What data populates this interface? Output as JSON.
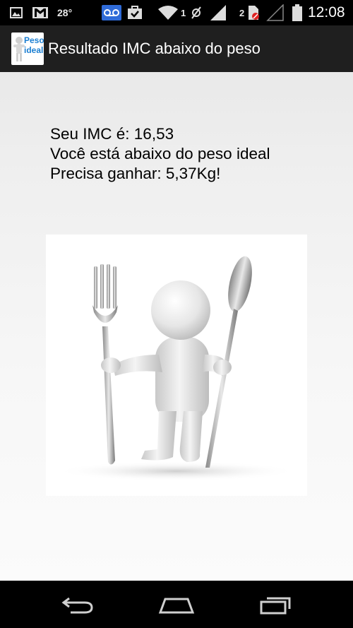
{
  "status_bar": {
    "temperature": "28°",
    "clock": "12:08",
    "sim1_label": "1",
    "sim2_label": "2",
    "icons": [
      "image-icon",
      "gmail-icon",
      "voicemail-icon",
      "task-icon",
      "wifi-icon",
      "signal-icon",
      "battery-icon"
    ]
  },
  "action_bar": {
    "icon_text_line1": "Peso",
    "icon_text_line2": "ideal",
    "title": "Resultado IMC abaixo do peso"
  },
  "result": {
    "line1": "Seu IMC é: 16,53",
    "line2": "Você está abaixo do peso ideal",
    "line3": "Precisa ganhar: 5,37Kg!"
  },
  "nav_bar": {
    "icons": [
      "back-icon",
      "home-icon",
      "recent-apps-icon"
    ]
  },
  "colors": {
    "status_bar_bg": "#000000",
    "action_bar_bg": "#1f1f1f",
    "icon_text": "#1b7fd2",
    "voicemail_bg": "#2f6bd8"
  }
}
